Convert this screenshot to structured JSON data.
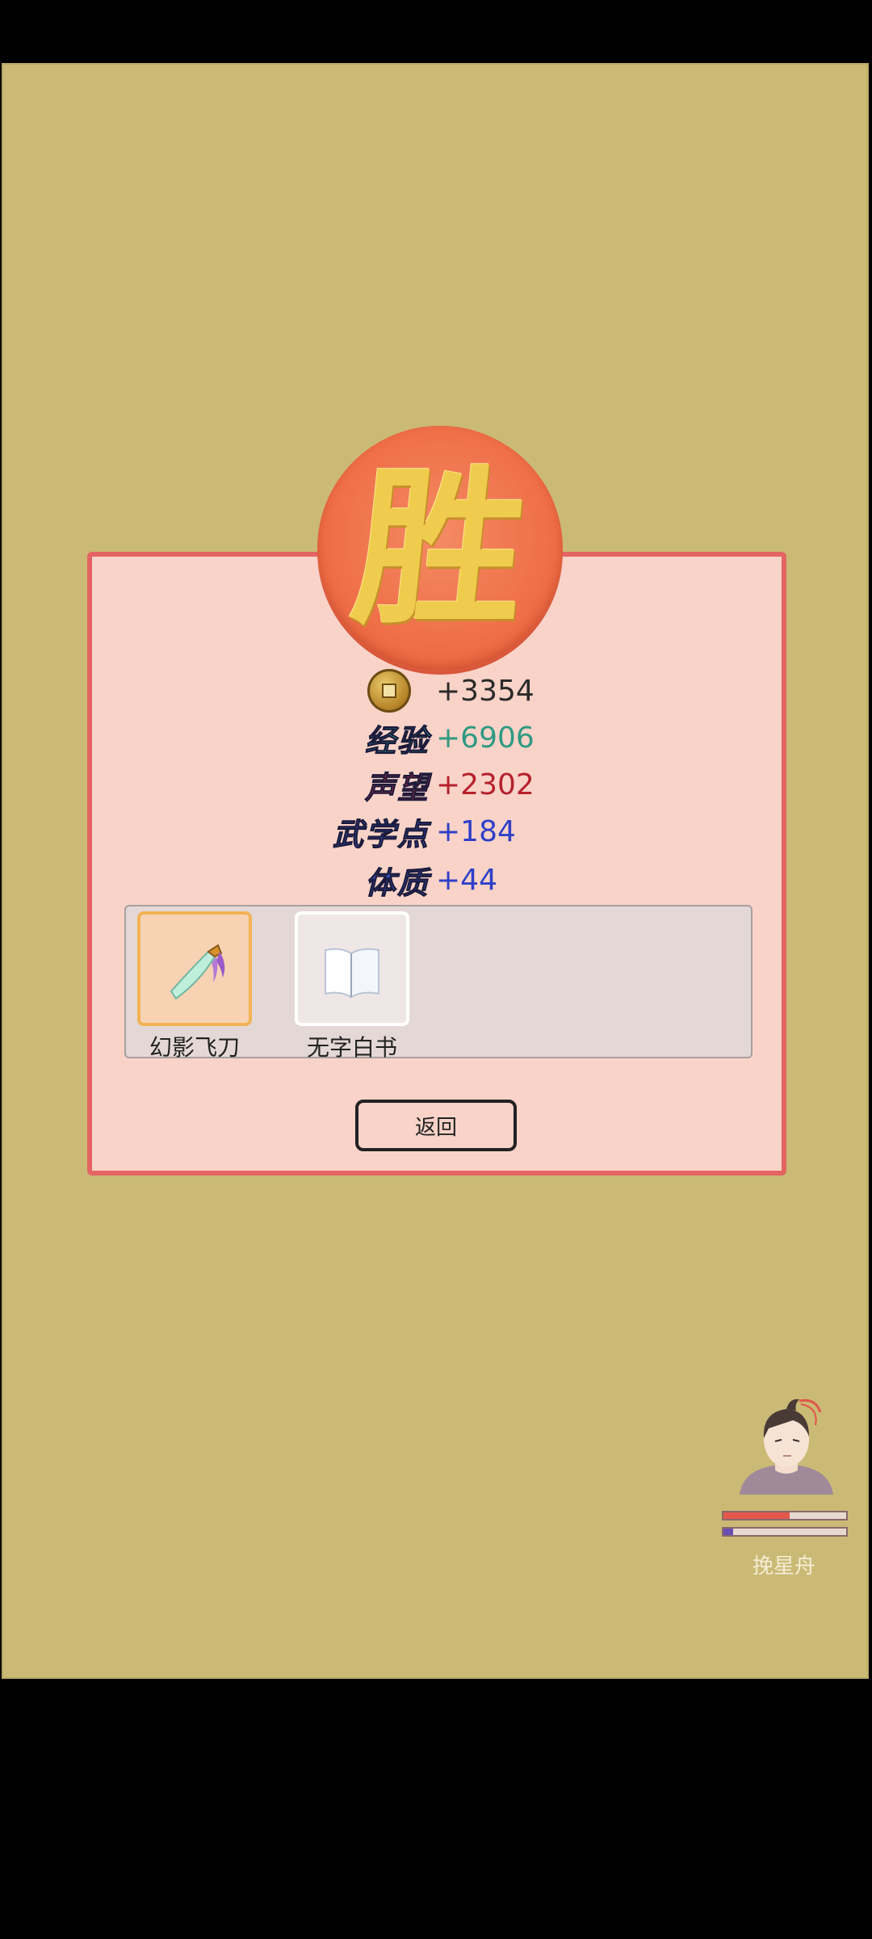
{
  "victory": {
    "char": "胜"
  },
  "rewards": [
    {
      "label": "",
      "value": "+3354",
      "icon": "coin-icon",
      "label_color": "",
      "value_color": "#2a2a2a"
    },
    {
      "label": "经验",
      "value": "+6906",
      "icon": "",
      "label_color": "#2f8f8a",
      "value_color": "#2f9a83"
    },
    {
      "label": "声望",
      "value": "+2302",
      "icon": "",
      "label_color": "#d62b4a",
      "value_color": "#b6202c"
    },
    {
      "label": "武学点",
      "value": "+184",
      "icon": "",
      "label_color": "#3a4fb3",
      "value_color": "#2f3fc7"
    },
    {
      "label": "体质",
      "value": "+44",
      "icon": "",
      "label_color": "#3a4fb3",
      "value_color": "#2f3fc7"
    }
  ],
  "items": [
    {
      "name": "幻影飞刀",
      "icon": "flying-dagger-icon",
      "rarity": "gold"
    },
    {
      "name": "无字白书",
      "icon": "blank-book-icon",
      "rarity": "white"
    }
  ],
  "back_button": {
    "label": "返回"
  },
  "hero": {
    "name": "挽星舟",
    "hp_fraction": 0.54,
    "mp_fraction": 0.08,
    "hp_color": "#e4574c",
    "mp_color": "#6a4fb3"
  },
  "colors": {
    "background": "#cbba75",
    "panel": "#f9d3c8",
    "panel_border": "#e46363",
    "seal": "#ef6f48",
    "seal_text": "#f0cc4e"
  }
}
